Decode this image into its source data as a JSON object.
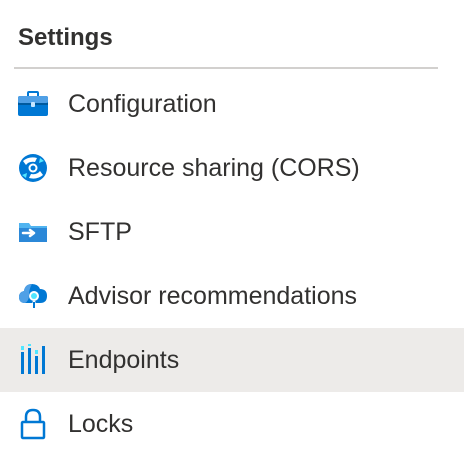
{
  "settings": {
    "title": "Settings",
    "items": [
      {
        "label": "Configuration",
        "icon": "toolbox-icon"
      },
      {
        "label": "Resource sharing (CORS)",
        "icon": "cors-icon"
      },
      {
        "label": "SFTP",
        "icon": "sftp-folder-icon"
      },
      {
        "label": "Advisor recommendations",
        "icon": "advisor-cloud-icon"
      },
      {
        "label": "Endpoints",
        "icon": "endpoints-bars-icon"
      },
      {
        "label": "Locks",
        "icon": "lock-icon"
      }
    ],
    "selected_index": 4
  },
  "colors": {
    "text": "#323130",
    "divider": "#d2d0ce",
    "selected_bg": "#edebe9",
    "azure_blue": "#0078d4",
    "light_blue": "#50e6ff"
  }
}
